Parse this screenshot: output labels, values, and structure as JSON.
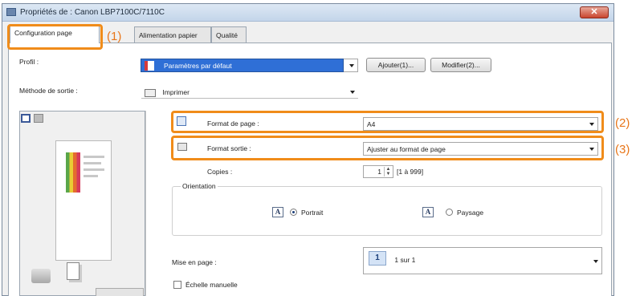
{
  "window": {
    "title": "Propriétés de : Canon LBP7100C/7110C",
    "close_label": "✕"
  },
  "tabs": [
    {
      "label": "Configuration page"
    },
    {
      "label": "Alimentation papier"
    },
    {
      "label": "Qualité"
    }
  ],
  "callouts": [
    "(1)",
    "(2)",
    "(3)"
  ],
  "profile": {
    "label": "Profil :",
    "selected": "Paramètres par défaut",
    "add_button": "Ajouter(1)...",
    "edit_button": "Modifier(2)..."
  },
  "output_method": {
    "label": "Méthode de sortie :",
    "selected": "Imprimer"
  },
  "page_size": {
    "label": "Format de page :",
    "selected": "A4"
  },
  "output_size": {
    "label": "Format sortie :",
    "selected": "Ajuster au format de page"
  },
  "copies": {
    "label": "Copies :",
    "value": "1",
    "range": "[1 à 999]"
  },
  "orientation": {
    "legend": "Orientation",
    "portrait_label": "Portrait",
    "landscape_label": "Paysage",
    "selected": "portrait",
    "icon_glyph": "A"
  },
  "layout": {
    "label": "Mise en page :",
    "value_number": "1",
    "selected": "1 sur 1"
  },
  "manual_scaling": {
    "label": "Échelle manuelle"
  },
  "colors": {
    "highlight": "#f08c1a",
    "callout": "#e8761a",
    "selection": "#2f6fd6"
  }
}
